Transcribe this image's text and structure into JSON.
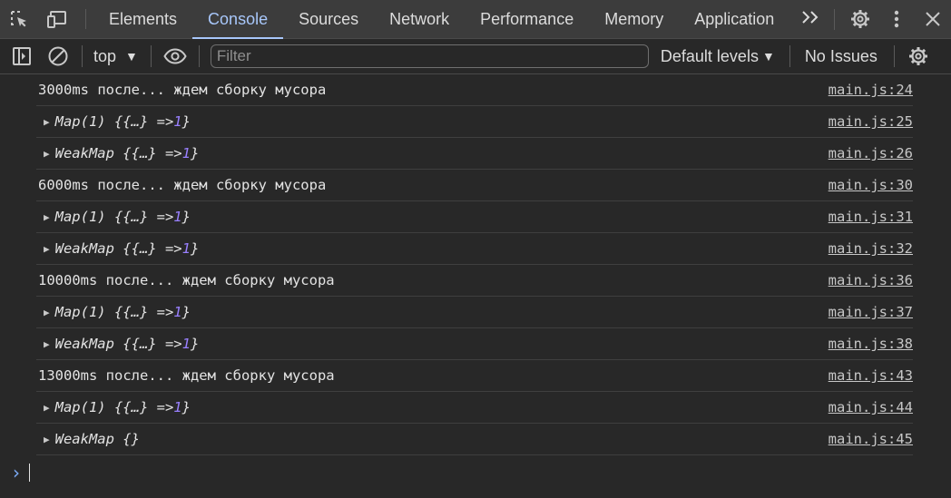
{
  "tabs": [
    {
      "label": "Elements",
      "active": false
    },
    {
      "label": "Console",
      "active": true
    },
    {
      "label": "Sources",
      "active": false
    },
    {
      "label": "Network",
      "active": false
    },
    {
      "label": "Performance",
      "active": false
    },
    {
      "label": "Memory",
      "active": false
    },
    {
      "label": "Application",
      "active": false
    }
  ],
  "toolbar": {
    "context": "top",
    "filter_placeholder": "Filter",
    "filter_value": "",
    "levels": "Default levels",
    "issues": "No Issues"
  },
  "entries": [
    {
      "kind": "log",
      "text": "3000ms после... ждем сборку мусора",
      "source": "main.js:24"
    },
    {
      "kind": "obj",
      "type": "Map(1)",
      "content": "{{…} => ",
      "num": "1",
      "close": "}",
      "source": "main.js:25"
    },
    {
      "kind": "obj",
      "type": "WeakMap",
      "content": "{{…} => ",
      "num": "1",
      "close": "}",
      "source": "main.js:26"
    },
    {
      "kind": "log",
      "text": "6000ms после... ждем сборку мусора",
      "source": "main.js:30"
    },
    {
      "kind": "obj",
      "type": "Map(1)",
      "content": "{{…} => ",
      "num": "1",
      "close": "}",
      "source": "main.js:31"
    },
    {
      "kind": "obj",
      "type": "WeakMap",
      "content": "{{…} => ",
      "num": "1",
      "close": "}",
      "source": "main.js:32"
    },
    {
      "kind": "log",
      "text": "10000ms после... ждем сборку мусора",
      "source": "main.js:36"
    },
    {
      "kind": "obj",
      "type": "Map(1)",
      "content": "{{…} => ",
      "num": "1",
      "close": "}",
      "source": "main.js:37"
    },
    {
      "kind": "obj",
      "type": "WeakMap",
      "content": "{{…} => ",
      "num": "1",
      "close": "}",
      "source": "main.js:38"
    },
    {
      "kind": "log",
      "text": "13000ms после... ждем сборку мусора",
      "source": "main.js:43"
    },
    {
      "kind": "obj",
      "type": "Map(1)",
      "content": "{{…} => ",
      "num": "1",
      "close": "}",
      "source": "main.js:44"
    },
    {
      "kind": "obj",
      "type": "WeakMap",
      "content": "{}",
      "num": "",
      "close": "",
      "source": "main.js:45"
    }
  ],
  "icons": {
    "inspect": "inspect-element-icon",
    "device": "device-toolbar-icon",
    "more_tabs": "more-tabs-chevron-icon",
    "settings": "gear-icon",
    "menu": "kebab-menu-icon",
    "close": "close-icon",
    "sidebar": "sidebar-toggle-icon",
    "clear": "clear-console-icon",
    "eye": "live-expression-eye-icon",
    "console_settings": "console-gear-icon",
    "prompt": "prompt-chevron-icon"
  },
  "colors": {
    "accent": "#a8c7fa",
    "number": "#9980ff",
    "background": "#282828",
    "tabbar": "#3c3c3c"
  }
}
